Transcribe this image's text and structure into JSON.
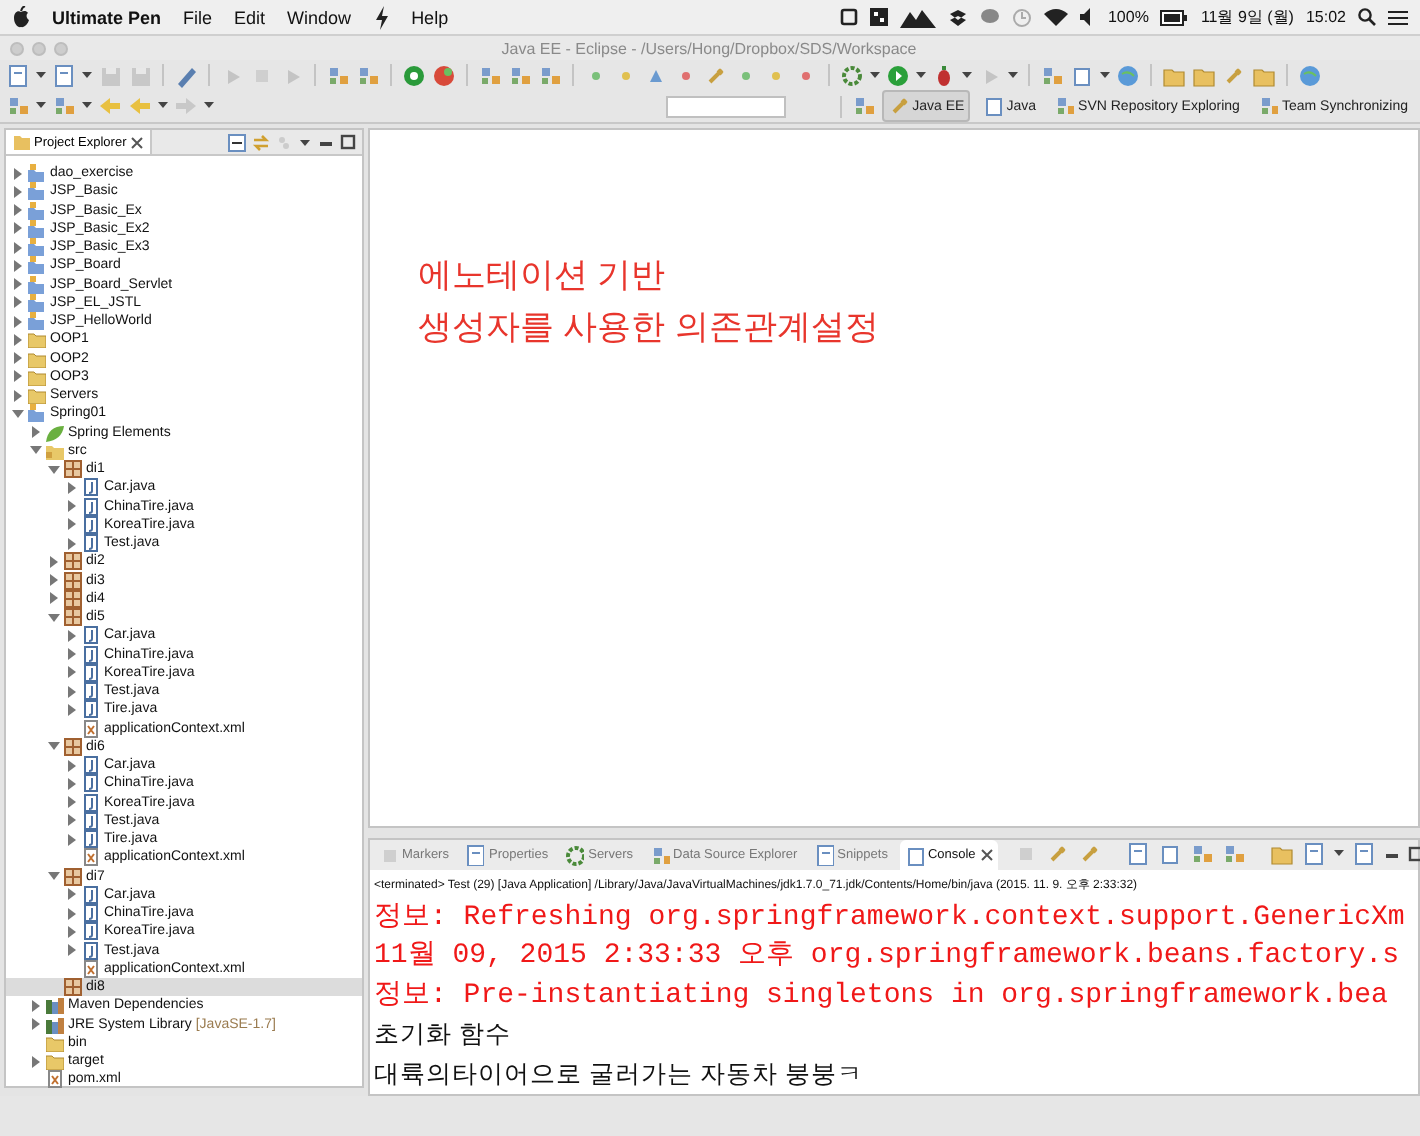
{
  "menubar": {
    "app": "Ultimate Pen",
    "menus": [
      "File",
      "Edit",
      "Window",
      "Help"
    ],
    "battery": "100%",
    "date": "11월 9일 (월)",
    "time": "15:02"
  },
  "window": {
    "title": "Java EE - Eclipse - /Users/Hong/Dropbox/SDS/Workspace"
  },
  "perspectives": [
    {
      "label": "Java EE",
      "selected": true
    },
    {
      "label": "Java",
      "selected": false
    },
    {
      "label": "SVN Repository Exploring",
      "selected": false
    },
    {
      "label": "Team Synchronizing",
      "selected": false
    }
  ],
  "explorer": {
    "title": "Project Explorer",
    "tree": [
      {
        "label": "dao_exercise",
        "kind": "project",
        "expanded": false,
        "selected": false
      },
      {
        "label": "JSP_Basic",
        "kind": "project",
        "expanded": false,
        "selected": false
      },
      {
        "label": "JSP_Basic_Ex",
        "kind": "project",
        "expanded": false,
        "selected": false
      },
      {
        "label": "JSP_Basic_Ex2",
        "kind": "project",
        "expanded": false,
        "selected": false
      },
      {
        "label": "JSP_Basic_Ex3",
        "kind": "project",
        "expanded": false,
        "selected": false
      },
      {
        "label": "JSP_Board",
        "kind": "project",
        "expanded": false,
        "selected": false
      },
      {
        "label": "JSP_Board_Servlet",
        "kind": "project",
        "expanded": false,
        "selected": false
      },
      {
        "label": "JSP_EL_JSTL",
        "kind": "project",
        "expanded": false,
        "selected": false
      },
      {
        "label": "JSP_HelloWorld",
        "kind": "project",
        "expanded": false,
        "selected": false
      },
      {
        "label": "OOP1",
        "kind": "folder",
        "expanded": false,
        "selected": false
      },
      {
        "label": "OOP2",
        "kind": "folder",
        "expanded": false,
        "selected": false
      },
      {
        "label": "OOP3",
        "kind": "folder",
        "expanded": false,
        "selected": false
      },
      {
        "label": "Servers",
        "kind": "folder",
        "expanded": false,
        "selected": false
      },
      {
        "label": "Spring01",
        "kind": "project",
        "expanded": true,
        "selected": false,
        "children": [
          {
            "label": "Spring Elements",
            "kind": "leaf",
            "expanded": false,
            "selected": false
          },
          {
            "label": "src",
            "kind": "source",
            "expanded": true,
            "selected": false,
            "children": [
              {
                "label": "di1",
                "kind": "package",
                "expanded": true,
                "selected": false,
                "children": [
                  {
                    "label": "Car.java",
                    "kind": "java",
                    "expanded": false,
                    "selected": false
                  },
                  {
                    "label": "ChinaTire.java",
                    "kind": "java",
                    "expanded": false,
                    "selected": false
                  },
                  {
                    "label": "KoreaTire.java",
                    "kind": "java",
                    "expanded": false,
                    "selected": false
                  },
                  {
                    "label": "Test.java",
                    "kind": "java",
                    "expanded": false,
                    "selected": false
                  }
                ]
              },
              {
                "label": "di2",
                "kind": "package",
                "expanded": false,
                "selected": false
              },
              {
                "label": "di3",
                "kind": "package",
                "expanded": false,
                "selected": false
              },
              {
                "label": "di4",
                "kind": "package",
                "expanded": false,
                "selected": false
              },
              {
                "label": "di5",
                "kind": "package",
                "expanded": true,
                "selected": false,
                "children": [
                  {
                    "label": "Car.java",
                    "kind": "java",
                    "expanded": false,
                    "selected": false
                  },
                  {
                    "label": "ChinaTire.java",
                    "kind": "java",
                    "expanded": false,
                    "selected": false
                  },
                  {
                    "label": "KoreaTire.java",
                    "kind": "java",
                    "expanded": false,
                    "selected": false
                  },
                  {
                    "label": "Test.java",
                    "kind": "java",
                    "expanded": false,
                    "selected": false
                  },
                  {
                    "label": "Tire.java",
                    "kind": "java",
                    "expanded": false,
                    "selected": false
                  },
                  {
                    "label": "applicationContext.xml",
                    "kind": "xml",
                    "selected": false
                  }
                ]
              },
              {
                "label": "di6",
                "kind": "package",
                "expanded": true,
                "selected": false,
                "children": [
                  {
                    "label": "Car.java",
                    "kind": "java",
                    "expanded": false,
                    "selected": false
                  },
                  {
                    "label": "ChinaTire.java",
                    "kind": "java",
                    "expanded": false,
                    "selected": false
                  },
                  {
                    "label": "KoreaTire.java",
                    "kind": "java",
                    "expanded": false,
                    "selected": false
                  },
                  {
                    "label": "Test.java",
                    "kind": "java",
                    "expanded": false,
                    "selected": false
                  },
                  {
                    "label": "Tire.java",
                    "kind": "java",
                    "expanded": false,
                    "selected": false
                  },
                  {
                    "label": "applicationContext.xml",
                    "kind": "xml",
                    "selected": false
                  }
                ]
              },
              {
                "label": "di7",
                "kind": "package",
                "expanded": true,
                "selected": false,
                "children": [
                  {
                    "label": "Car.java",
                    "kind": "java",
                    "expanded": false,
                    "selected": false
                  },
                  {
                    "label": "ChinaTire.java",
                    "kind": "java",
                    "expanded": false,
                    "selected": false
                  },
                  {
                    "label": "KoreaTire.java",
                    "kind": "java",
                    "expanded": false,
                    "selected": false
                  },
                  {
                    "label": "Test.java",
                    "kind": "java",
                    "expanded": false,
                    "selected": false
                  },
                  {
                    "label": "applicationContext.xml",
                    "kind": "xml",
                    "selected": false
                  }
                ]
              },
              {
                "label": "di8",
                "kind": "package",
                "selected": true
              }
            ]
          },
          {
            "label": "Maven Dependencies",
            "kind": "library",
            "expanded": false,
            "selected": false
          },
          {
            "label": "JRE System Library",
            "decoration": "[JavaSE-1.7]",
            "kind": "library",
            "expanded": false,
            "selected": false
          },
          {
            "label": "bin",
            "kind": "folder",
            "selected": false
          },
          {
            "label": "target",
            "kind": "folder",
            "expanded": false,
            "selected": false
          },
          {
            "label": "pom.xml",
            "kind": "xml",
            "selected": false
          }
        ]
      }
    ]
  },
  "editor": {
    "lines": [
      "에노테이션 기반",
      "생성자를 사용한 의존관계설정"
    ]
  },
  "bottom_tabs": [
    {
      "label": "Markers",
      "selected": false
    },
    {
      "label": "Properties",
      "selected": false
    },
    {
      "label": "Servers",
      "selected": false
    },
    {
      "label": "Data Source Explorer",
      "selected": false
    },
    {
      "label": "Snippets",
      "selected": false
    },
    {
      "label": "Console",
      "selected": true
    }
  ],
  "console": {
    "status": "<terminated> Test (29) [Java Application] /Library/Java/JavaVirtualMachines/jdk1.7.0_71.jdk/Contents/Home/bin/java (2015. 11. 9. 오후 2:33:32)",
    "lines": [
      {
        "kind": "error",
        "text": "정보: Refreshing org.springframework.context.support.GenericXm"
      },
      {
        "kind": "error",
        "text": "11월 09, 2015 2:33:33 오후 org.springframework.beans.factory.s"
      },
      {
        "kind": "error",
        "text": "정보: Pre-instantiating singletons in org.springframework.bea"
      },
      {
        "kind": "output",
        "text": "초기화 함수"
      },
      {
        "kind": "output",
        "text": "대륙의타이어으로 굴러가는 자동차 붕붕ㅋ"
      }
    ]
  }
}
